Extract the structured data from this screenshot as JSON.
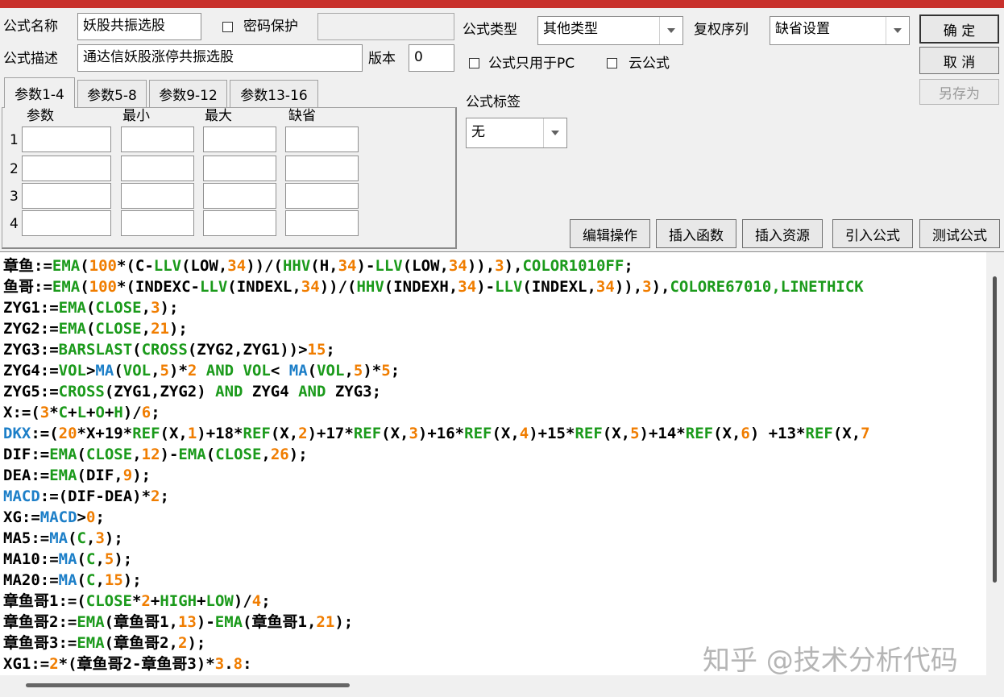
{
  "form": {
    "name_label": "公式名称",
    "name_value": "妖股共振选股",
    "password_label": "密码保护",
    "desc_label": "公式描述",
    "desc_value": "通达信妖股涨停共振选股",
    "version_label": "版本",
    "version_value": "0",
    "type_label": "公式类型",
    "type_value": "其他类型",
    "adjust_label": "复权序列",
    "adjust_value": "缺省设置",
    "pc_only_label": "公式只用于PC",
    "cloud_label": "云公式",
    "tag_label": "公式标签",
    "tag_value": "无"
  },
  "buttons": {
    "ok": "确  定",
    "cancel": "取  消",
    "save_as": "另存为",
    "edit_ops": "编辑操作",
    "insert_func": "插入函数",
    "insert_res": "插入资源",
    "import_formula": "引入公式",
    "test_formula": "测试公式"
  },
  "tabs": [
    "参数1-4",
    "参数5-8",
    "参数9-12",
    "参数13-16"
  ],
  "params": {
    "headers": [
      "参数",
      "最小",
      "最大",
      "缺省"
    ],
    "rows": [
      "1",
      "2",
      "3",
      "4"
    ]
  },
  "code_colors": {
    "default": "#000000",
    "function": "#1b9a1b",
    "number": "#f07d00",
    "keyword": "#1d7fc8"
  },
  "code": [
    [
      [
        "d",
        "章鱼:="
      ],
      [
        "f",
        "EMA"
      ],
      [
        "d",
        "("
      ],
      [
        "n",
        "100"
      ],
      [
        "d",
        "*(C-"
      ],
      [
        "f",
        "LLV"
      ],
      [
        "d",
        "(LOW,"
      ],
      [
        "n",
        "34"
      ],
      [
        "d",
        "))/("
      ],
      [
        "f",
        "HHV"
      ],
      [
        "d",
        "(H,"
      ],
      [
        "n",
        "34"
      ],
      [
        "d",
        ")-"
      ],
      [
        "f",
        "LLV"
      ],
      [
        "d",
        "(LOW,"
      ],
      [
        "n",
        "34"
      ],
      [
        "d",
        ")),"
      ],
      [
        "n",
        "3"
      ],
      [
        "d",
        "),"
      ],
      [
        "f",
        "COLOR1010FF"
      ],
      [
        "d",
        ";"
      ]
    ],
    [
      [
        "d",
        "鱼哥:="
      ],
      [
        "f",
        "EMA"
      ],
      [
        "d",
        "("
      ],
      [
        "n",
        "100"
      ],
      [
        "d",
        "*(INDEXC-"
      ],
      [
        "f",
        "LLV"
      ],
      [
        "d",
        "(INDEXL,"
      ],
      [
        "n",
        "34"
      ],
      [
        "d",
        "))/("
      ],
      [
        "f",
        "HHV"
      ],
      [
        "d",
        "(INDEXH,"
      ],
      [
        "n",
        "34"
      ],
      [
        "d",
        ")-"
      ],
      [
        "f",
        "LLV"
      ],
      [
        "d",
        "(INDEXL,"
      ],
      [
        "n",
        "34"
      ],
      [
        "d",
        ")),"
      ],
      [
        "n",
        "3"
      ],
      [
        "d",
        "),"
      ],
      [
        "f",
        "COLORE67010,LINETHICK"
      ]
    ],
    [
      [
        "d",
        "ZYG1:="
      ],
      [
        "f",
        "EMA"
      ],
      [
        "d",
        "("
      ],
      [
        "f",
        "CLOSE"
      ],
      [
        "d",
        ","
      ],
      [
        "n",
        "3"
      ],
      [
        "d",
        ");"
      ]
    ],
    [
      [
        "d",
        "ZYG2:="
      ],
      [
        "f",
        "EMA"
      ],
      [
        "d",
        "("
      ],
      [
        "f",
        "CLOSE"
      ],
      [
        "d",
        ","
      ],
      [
        "n",
        "21"
      ],
      [
        "d",
        ");"
      ]
    ],
    [
      [
        "d",
        "ZYG3:="
      ],
      [
        "f",
        "BARSLAST"
      ],
      [
        "d",
        "("
      ],
      [
        "f",
        "CROSS"
      ],
      [
        "d",
        "(ZYG2,ZYG1))>"
      ],
      [
        "n",
        "15"
      ],
      [
        "d",
        ";"
      ]
    ],
    [
      [
        "d",
        "ZYG4:="
      ],
      [
        "f",
        "VOL"
      ],
      [
        "d",
        ">"
      ],
      [
        "k",
        "MA"
      ],
      [
        "d",
        "("
      ],
      [
        "f",
        "VOL"
      ],
      [
        "d",
        ","
      ],
      [
        "n",
        "5"
      ],
      [
        "d",
        ")*"
      ],
      [
        "n",
        "2"
      ],
      [
        "f",
        " AND "
      ],
      [
        "f",
        "VOL"
      ],
      [
        "d",
        "< "
      ],
      [
        "k",
        "MA"
      ],
      [
        "d",
        "("
      ],
      [
        "f",
        "VOL"
      ],
      [
        "d",
        ","
      ],
      [
        "n",
        "5"
      ],
      [
        "d",
        ")*"
      ],
      [
        "n",
        "5"
      ],
      [
        "d",
        ";"
      ]
    ],
    [
      [
        "d",
        "ZYG5:="
      ],
      [
        "f",
        "CROSS"
      ],
      [
        "d",
        "(ZYG1,ZYG2) "
      ],
      [
        "f",
        "AND"
      ],
      [
        "d",
        " ZYG4 "
      ],
      [
        "f",
        "AND"
      ],
      [
        "d",
        " ZYG3;"
      ]
    ],
    [
      [
        "d",
        "X:=("
      ],
      [
        "n",
        "3"
      ],
      [
        "d",
        "*"
      ],
      [
        "f",
        "C"
      ],
      [
        "d",
        "+"
      ],
      [
        "f",
        "L"
      ],
      [
        "d",
        "+"
      ],
      [
        "f",
        "O"
      ],
      [
        "d",
        "+"
      ],
      [
        "f",
        "H"
      ],
      [
        "d",
        ")/"
      ],
      [
        "n",
        "6"
      ],
      [
        "d",
        ";"
      ]
    ],
    [
      [
        "k",
        "DKX"
      ],
      [
        "d",
        ":=("
      ],
      [
        "n",
        "20"
      ],
      [
        "d",
        "*X+19*"
      ],
      [
        "f",
        "REF"
      ],
      [
        "d",
        "(X,"
      ],
      [
        "n",
        "1"
      ],
      [
        "d",
        ")+18*"
      ],
      [
        "f",
        "REF"
      ],
      [
        "d",
        "(X,"
      ],
      [
        "n",
        "2"
      ],
      [
        "d",
        ")+17*"
      ],
      [
        "f",
        "REF"
      ],
      [
        "d",
        "(X,"
      ],
      [
        "n",
        "3"
      ],
      [
        "d",
        ")+16*"
      ],
      [
        "f",
        "REF"
      ],
      [
        "d",
        "(X,"
      ],
      [
        "n",
        "4"
      ],
      [
        "d",
        ")+15*"
      ],
      [
        "f",
        "REF"
      ],
      [
        "d",
        "(X,"
      ],
      [
        "n",
        "5"
      ],
      [
        "d",
        ")+14*"
      ],
      [
        "f",
        "REF"
      ],
      [
        "d",
        "(X,"
      ],
      [
        "n",
        "6"
      ],
      [
        "d",
        ") +13*"
      ],
      [
        "f",
        "REF"
      ],
      [
        "d",
        "(X,"
      ],
      [
        "n",
        "7"
      ]
    ],
    [
      [
        "d",
        "DIF:="
      ],
      [
        "f",
        "EMA"
      ],
      [
        "d",
        "("
      ],
      [
        "f",
        "CLOSE"
      ],
      [
        "d",
        ","
      ],
      [
        "n",
        "12"
      ],
      [
        "d",
        ")-"
      ],
      [
        "f",
        "EMA"
      ],
      [
        "d",
        "("
      ],
      [
        "f",
        "CLOSE"
      ],
      [
        "d",
        ","
      ],
      [
        "n",
        "26"
      ],
      [
        "d",
        ");"
      ]
    ],
    [
      [
        "d",
        "DEA:="
      ],
      [
        "f",
        "EMA"
      ],
      [
        "d",
        "(DIF,"
      ],
      [
        "n",
        "9"
      ],
      [
        "d",
        ");"
      ]
    ],
    [
      [
        "k",
        "MACD"
      ],
      [
        "d",
        ":=(DIF-DEA)*"
      ],
      [
        "n",
        "2"
      ],
      [
        "d",
        ";"
      ]
    ],
    [
      [
        "d",
        "XG:="
      ],
      [
        "k",
        "MACD"
      ],
      [
        "d",
        ">"
      ],
      [
        "n",
        "0"
      ],
      [
        "d",
        ";"
      ]
    ],
    [
      [
        "d",
        "MA5:="
      ],
      [
        "k",
        "MA"
      ],
      [
        "d",
        "("
      ],
      [
        "f",
        "C"
      ],
      [
        "d",
        ","
      ],
      [
        "n",
        "3"
      ],
      [
        "d",
        ");"
      ]
    ],
    [
      [
        "d",
        "MA10:="
      ],
      [
        "k",
        "MA"
      ],
      [
        "d",
        "("
      ],
      [
        "f",
        "C"
      ],
      [
        "d",
        ","
      ],
      [
        "n",
        "5"
      ],
      [
        "d",
        ");"
      ]
    ],
    [
      [
        "d",
        "MA20:="
      ],
      [
        "k",
        "MA"
      ],
      [
        "d",
        "("
      ],
      [
        "f",
        "C"
      ],
      [
        "d",
        ","
      ],
      [
        "n",
        "15"
      ],
      [
        "d",
        ");"
      ]
    ],
    [
      [
        "d",
        "章鱼哥1:=("
      ],
      [
        "f",
        "CLOSE"
      ],
      [
        "d",
        "*"
      ],
      [
        "n",
        "2"
      ],
      [
        "d",
        "+"
      ],
      [
        "f",
        "HIGH"
      ],
      [
        "d",
        "+"
      ],
      [
        "f",
        "LOW"
      ],
      [
        "d",
        ")/"
      ],
      [
        "n",
        "4"
      ],
      [
        "d",
        ";"
      ]
    ],
    [
      [
        "d",
        "章鱼哥2:="
      ],
      [
        "f",
        "EMA"
      ],
      [
        "d",
        "(章鱼哥1,"
      ],
      [
        "n",
        "13"
      ],
      [
        "d",
        ")-"
      ],
      [
        "f",
        "EMA"
      ],
      [
        "d",
        "(章鱼哥1,"
      ],
      [
        "n",
        "21"
      ],
      [
        "d",
        ");"
      ]
    ],
    [
      [
        "d",
        "章鱼哥3:="
      ],
      [
        "f",
        "EMA"
      ],
      [
        "d",
        "(章鱼哥2,"
      ],
      [
        "n",
        "2"
      ],
      [
        "d",
        ");"
      ]
    ],
    [
      [
        "d",
        "XG1:="
      ],
      [
        "n",
        "2"
      ],
      [
        "d",
        "*(章鱼哥2-章鱼哥3)*"
      ],
      [
        "n",
        "3"
      ],
      [
        "d",
        "."
      ],
      [
        "n",
        "8"
      ],
      [
        "d",
        ":"
      ]
    ]
  ],
  "watermark": "知乎 @技术分析代码"
}
